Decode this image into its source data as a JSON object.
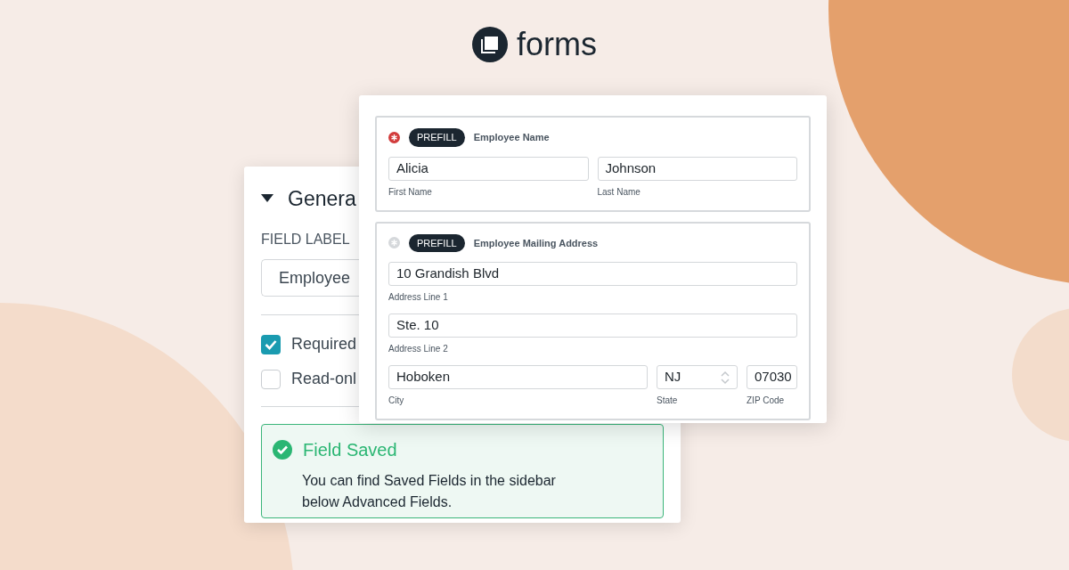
{
  "logo": {
    "text": "forms"
  },
  "settings_card": {
    "section_title": "Genera",
    "expanded": true,
    "field_label_heading": "FIELD LABEL",
    "field_label_value": "Employee",
    "options": [
      {
        "label": "Required",
        "checked": true
      },
      {
        "label": "Read-onl",
        "checked": false
      }
    ],
    "toast": {
      "title": "Field Saved",
      "message": "You can find Saved Fields in the sidebar below Advanced Fields."
    }
  },
  "form_card": {
    "groups": [
      {
        "required": true,
        "badge": "PREFILL",
        "title": "Employee Name",
        "rows": [
          [
            {
              "kind": "text",
              "value": "Alicia",
              "label": "First Name"
            },
            {
              "kind": "text",
              "value": "Johnson",
              "label": "Last Name"
            }
          ]
        ]
      },
      {
        "required": false,
        "badge": "PREFILL",
        "title": "Employee Mailing Address",
        "rows": [
          [
            {
              "kind": "text",
              "value": "10 Grandish Blvd",
              "label": "Address Line 1"
            }
          ],
          [
            {
              "kind": "text",
              "value": "Ste. 10",
              "label": "Address Line 2"
            }
          ],
          [
            {
              "kind": "text",
              "value": "Hoboken",
              "label": "City"
            },
            {
              "kind": "select",
              "value": "NJ",
              "label": "State"
            },
            {
              "kind": "short",
              "value": "07030",
              "label": "ZIP Code"
            }
          ]
        ]
      }
    ]
  }
}
